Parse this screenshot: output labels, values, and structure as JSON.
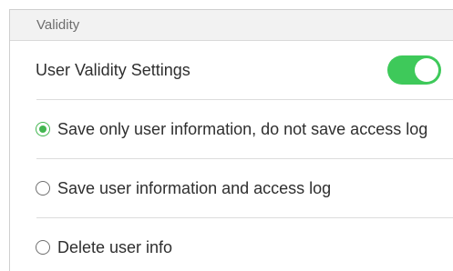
{
  "section": {
    "title": "Validity"
  },
  "validity_setting": {
    "label": "User Validity Settings",
    "enabled": true,
    "toggle_color": "#3ec95a"
  },
  "options": [
    {
      "label": "Save only user information, do not save access log",
      "selected": true
    },
    {
      "label": "Save user information and access log",
      "selected": false
    },
    {
      "label": "Delete user info",
      "selected": false
    }
  ],
  "colors": {
    "accent": "#43b650",
    "header_bg": "#f2f2f2",
    "text": "#2f2f2f"
  }
}
